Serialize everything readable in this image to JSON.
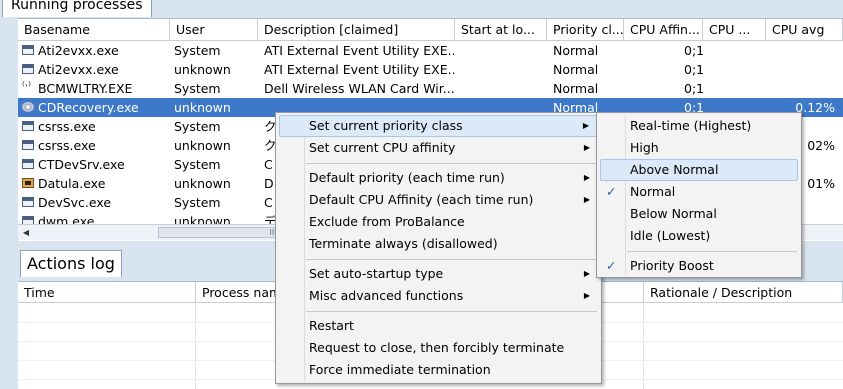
{
  "tab_running": "Running processes",
  "columns": [
    "Basename",
    "User",
    "Description [claimed]",
    "Start at lo...",
    "Priority cl...",
    "CPU Affin...",
    "CPU ...",
    "CPU avg"
  ],
  "processes": [
    {
      "name": "Ati2evxx.exe",
      "user": "System",
      "desc": "ATI External Event Utility EXE...",
      "priority": "Normal",
      "affinity": "0;1",
      "cpu": "",
      "avg": "",
      "icon": "window-icon"
    },
    {
      "name": "Ati2evxx.exe",
      "user": "unknown",
      "desc": "ATI External Event Utility EXE...",
      "priority": "Normal",
      "affinity": "0;1",
      "cpu": "",
      "avg": "",
      "icon": "window-icon"
    },
    {
      "name": "BCMWLTRY.EXE",
      "user": "System",
      "desc": "Dell Wireless WLAN Card Wir...",
      "priority": "Normal",
      "affinity": "0;1",
      "cpu": "",
      "avg": "",
      "icon": "wireless-icon"
    },
    {
      "name": "CDRecovery.exe",
      "user": "unknown",
      "desc": "",
      "priority": "Normal",
      "affinity": "0;1",
      "cpu": "",
      "avg": "0.12%",
      "icon": "cd-icon",
      "selected": true
    },
    {
      "name": "csrss.exe",
      "user": "System",
      "desc": "ク",
      "priority": "",
      "affinity": "",
      "cpu": "",
      "avg": "",
      "icon": "window-icon"
    },
    {
      "name": "csrss.exe",
      "user": "unknown",
      "desc": "ク",
      "priority": "",
      "affinity": "",
      "cpu": "",
      "avg": "02%",
      "icon": "window-icon"
    },
    {
      "name": "CTDevSrv.exe",
      "user": "System",
      "desc": "C",
      "priority": "",
      "affinity": "",
      "cpu": "",
      "avg": "",
      "icon": "window-icon"
    },
    {
      "name": "Datula.exe",
      "user": "unknown",
      "desc": "D",
      "priority": "",
      "affinity": "",
      "cpu": "",
      "avg": "01%",
      "icon": "datula-icon"
    },
    {
      "name": "DevSvc.exe",
      "user": "System",
      "desc": "C",
      "priority": "",
      "affinity": "",
      "cpu": "",
      "avg": "",
      "icon": "window-icon"
    },
    {
      "name": "dwm.exe",
      "user": "unknown",
      "desc": "デ",
      "priority": "",
      "affinity": "",
      "cpu": "",
      "avg": "",
      "icon": "window-icon"
    }
  ],
  "scroll": {
    "left_arrow": "◀",
    "grip": "III"
  },
  "tab_actions": "Actions log",
  "log_columns": [
    "Time",
    "Process nam",
    "Rationale / Description"
  ],
  "context_menu": {
    "items": [
      {
        "label": "Set current priority class",
        "submenu": true,
        "highlighted": true
      },
      {
        "label": "Set current CPU affinity",
        "submenu": true
      },
      {
        "separator": true
      },
      {
        "label": "Default priority (each time run)",
        "submenu": true
      },
      {
        "label": "Default CPU Affinity (each time run)",
        "submenu": true
      },
      {
        "label": "Exclude from ProBalance"
      },
      {
        "label": "Terminate always (disallowed)"
      },
      {
        "separator": true
      },
      {
        "label": "Set auto-startup type",
        "submenu": true
      },
      {
        "label": "Misc advanced functions",
        "submenu": true
      },
      {
        "separator": true
      },
      {
        "label": "Restart"
      },
      {
        "label": "Request to close, then forcibly terminate"
      },
      {
        "label": "Force immediate termination"
      }
    ]
  },
  "priority_submenu": {
    "items": [
      {
        "label": "Real-time (Highest)"
      },
      {
        "label": "High"
      },
      {
        "label": "Above Normal",
        "highlighted": true
      },
      {
        "label": "Normal",
        "checked": true
      },
      {
        "label": "Below Normal"
      },
      {
        "label": "Idle (Lowest)"
      },
      {
        "separator": true
      },
      {
        "label": "Priority Boost",
        "checked": true
      }
    ]
  },
  "glyphs": {
    "check": "✓",
    "submenu_arrow": "▶"
  },
  "colors": {
    "selection": "#3e78c9",
    "menu_highlight": "#dbe9f8",
    "check": "#2a5fb0"
  }
}
